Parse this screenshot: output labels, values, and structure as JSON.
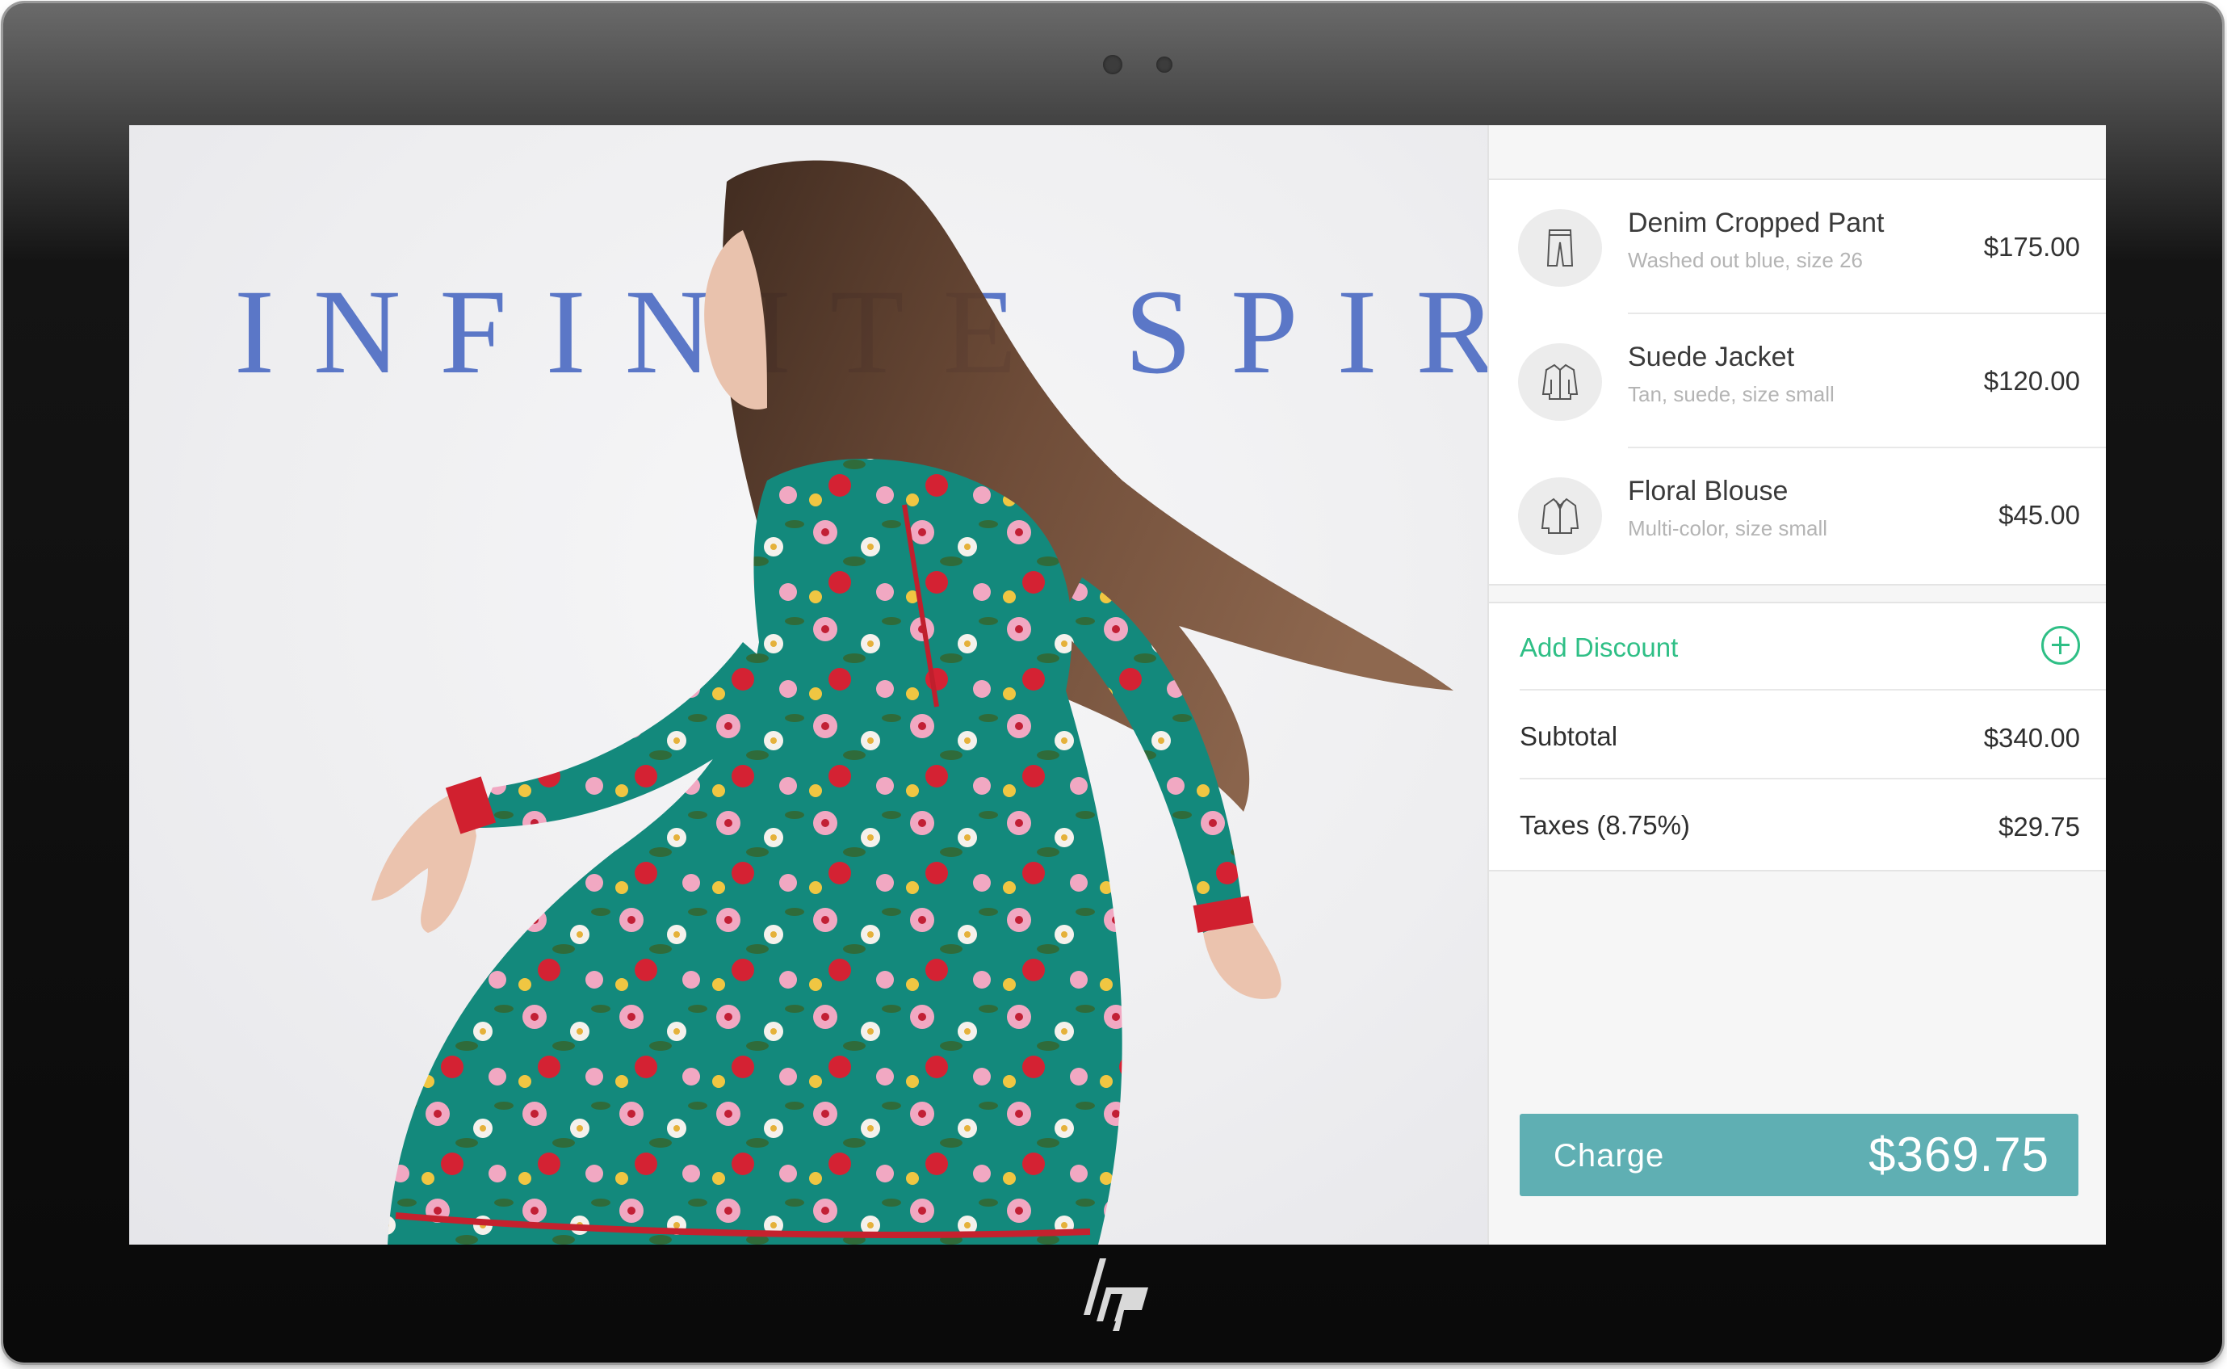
{
  "hero": {
    "title": "INFINITE SPIRIT"
  },
  "cart": {
    "items": [
      {
        "name": "Denim Cropped Pant",
        "description": "Washed out blue, size 26",
        "price": "$175.00",
        "icon": "pants-icon"
      },
      {
        "name": "Suede Jacket",
        "description": "Tan, suede, size small",
        "price": "$120.00",
        "icon": "jacket-icon"
      },
      {
        "name": "Floral Blouse",
        "description": "Multi-color, size small",
        "price": "$45.00",
        "icon": "blouse-icon"
      }
    ],
    "discount": {
      "label": "Add Discount",
      "icon": "plus-circle-icon"
    },
    "subtotal": {
      "label": "Subtotal",
      "value": "$340.00"
    },
    "taxes": {
      "label": "Taxes (8.75%)",
      "value": "$29.75"
    },
    "charge": {
      "label": "Charge",
      "amount": "$369.75"
    }
  },
  "colors": {
    "accent": "#2fbf86",
    "charge": "#5fafb3",
    "title": "#5b77c7"
  }
}
